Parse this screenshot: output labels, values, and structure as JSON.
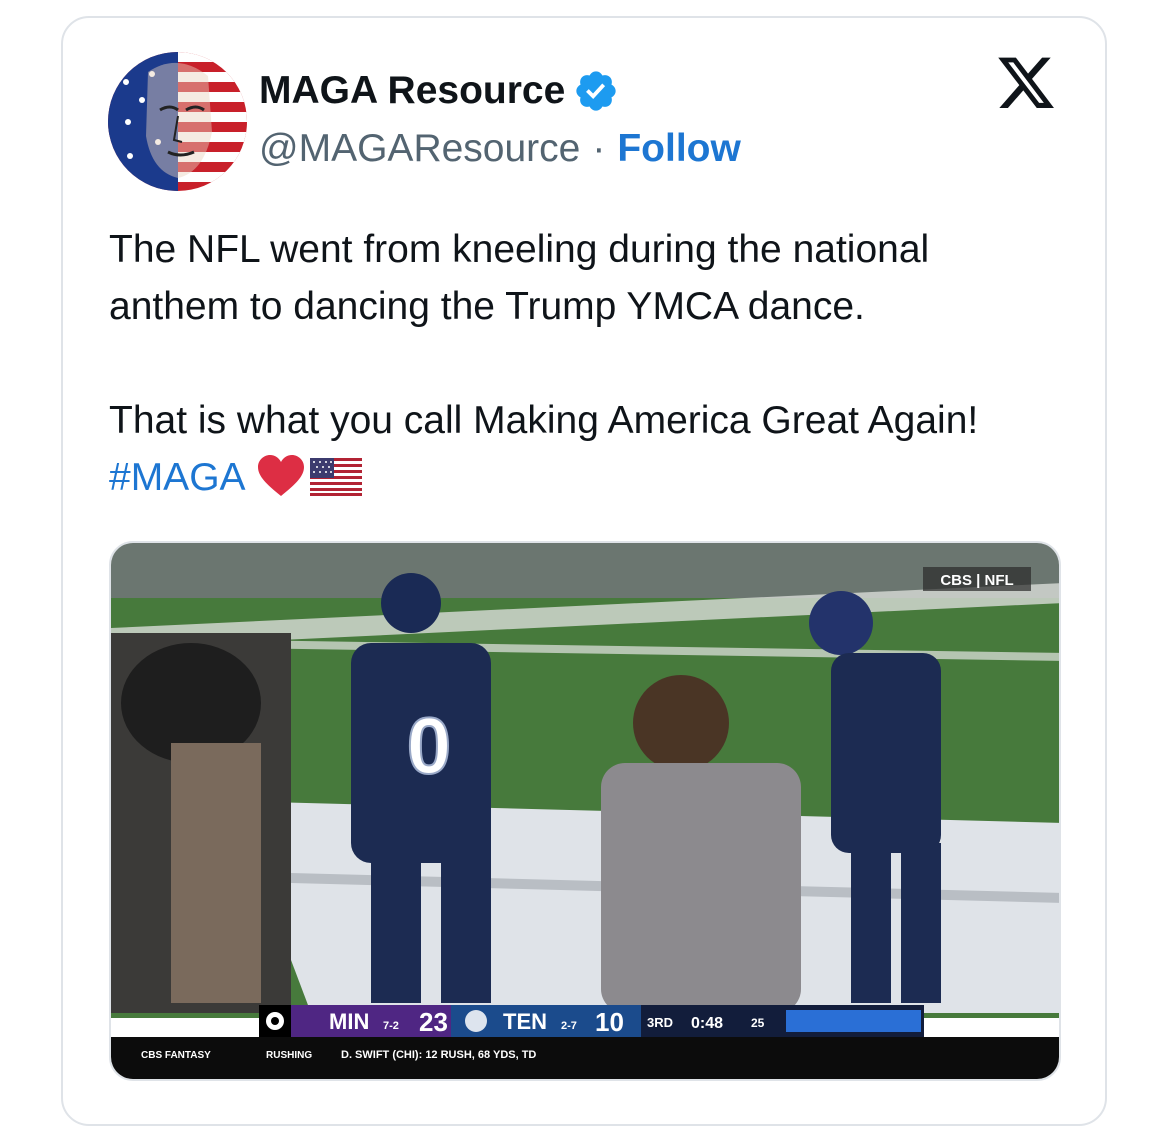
{
  "author": {
    "display_name": "MAGA Resource",
    "handle": "@MAGAResource",
    "separator": "·",
    "follow_label": "Follow",
    "verified": true
  },
  "tweet": {
    "line1": "The NFL went from kneeling during the national anthem to dancing the Trump YMCA dance.",
    "line2_text": "That is what you call Making America Great Again! ",
    "hashtag": "#MAGA",
    "emojis": [
      "heart",
      "us-flag"
    ]
  },
  "video": {
    "network_bug": "CBS | NFL",
    "scorebug": {
      "team1": "MIN",
      "team1_record": "7-2",
      "team1_score": "23",
      "team2": "TEN",
      "team2_record": "2-7",
      "team2_score": "10",
      "quarter": "3RD",
      "clock": "0:48",
      "play_clock": "25"
    },
    "ticker": {
      "brand": "CBS FANTASY",
      "category": "RUSHING",
      "stat": "D. SWIFT (CHI): 12 RUSH, 68 YDS, TD"
    },
    "jersey_number": "0"
  },
  "colors": {
    "link": "#1d76d2",
    "text": "#0f1419",
    "muted": "#536471",
    "verified": "#1d9bf0"
  }
}
